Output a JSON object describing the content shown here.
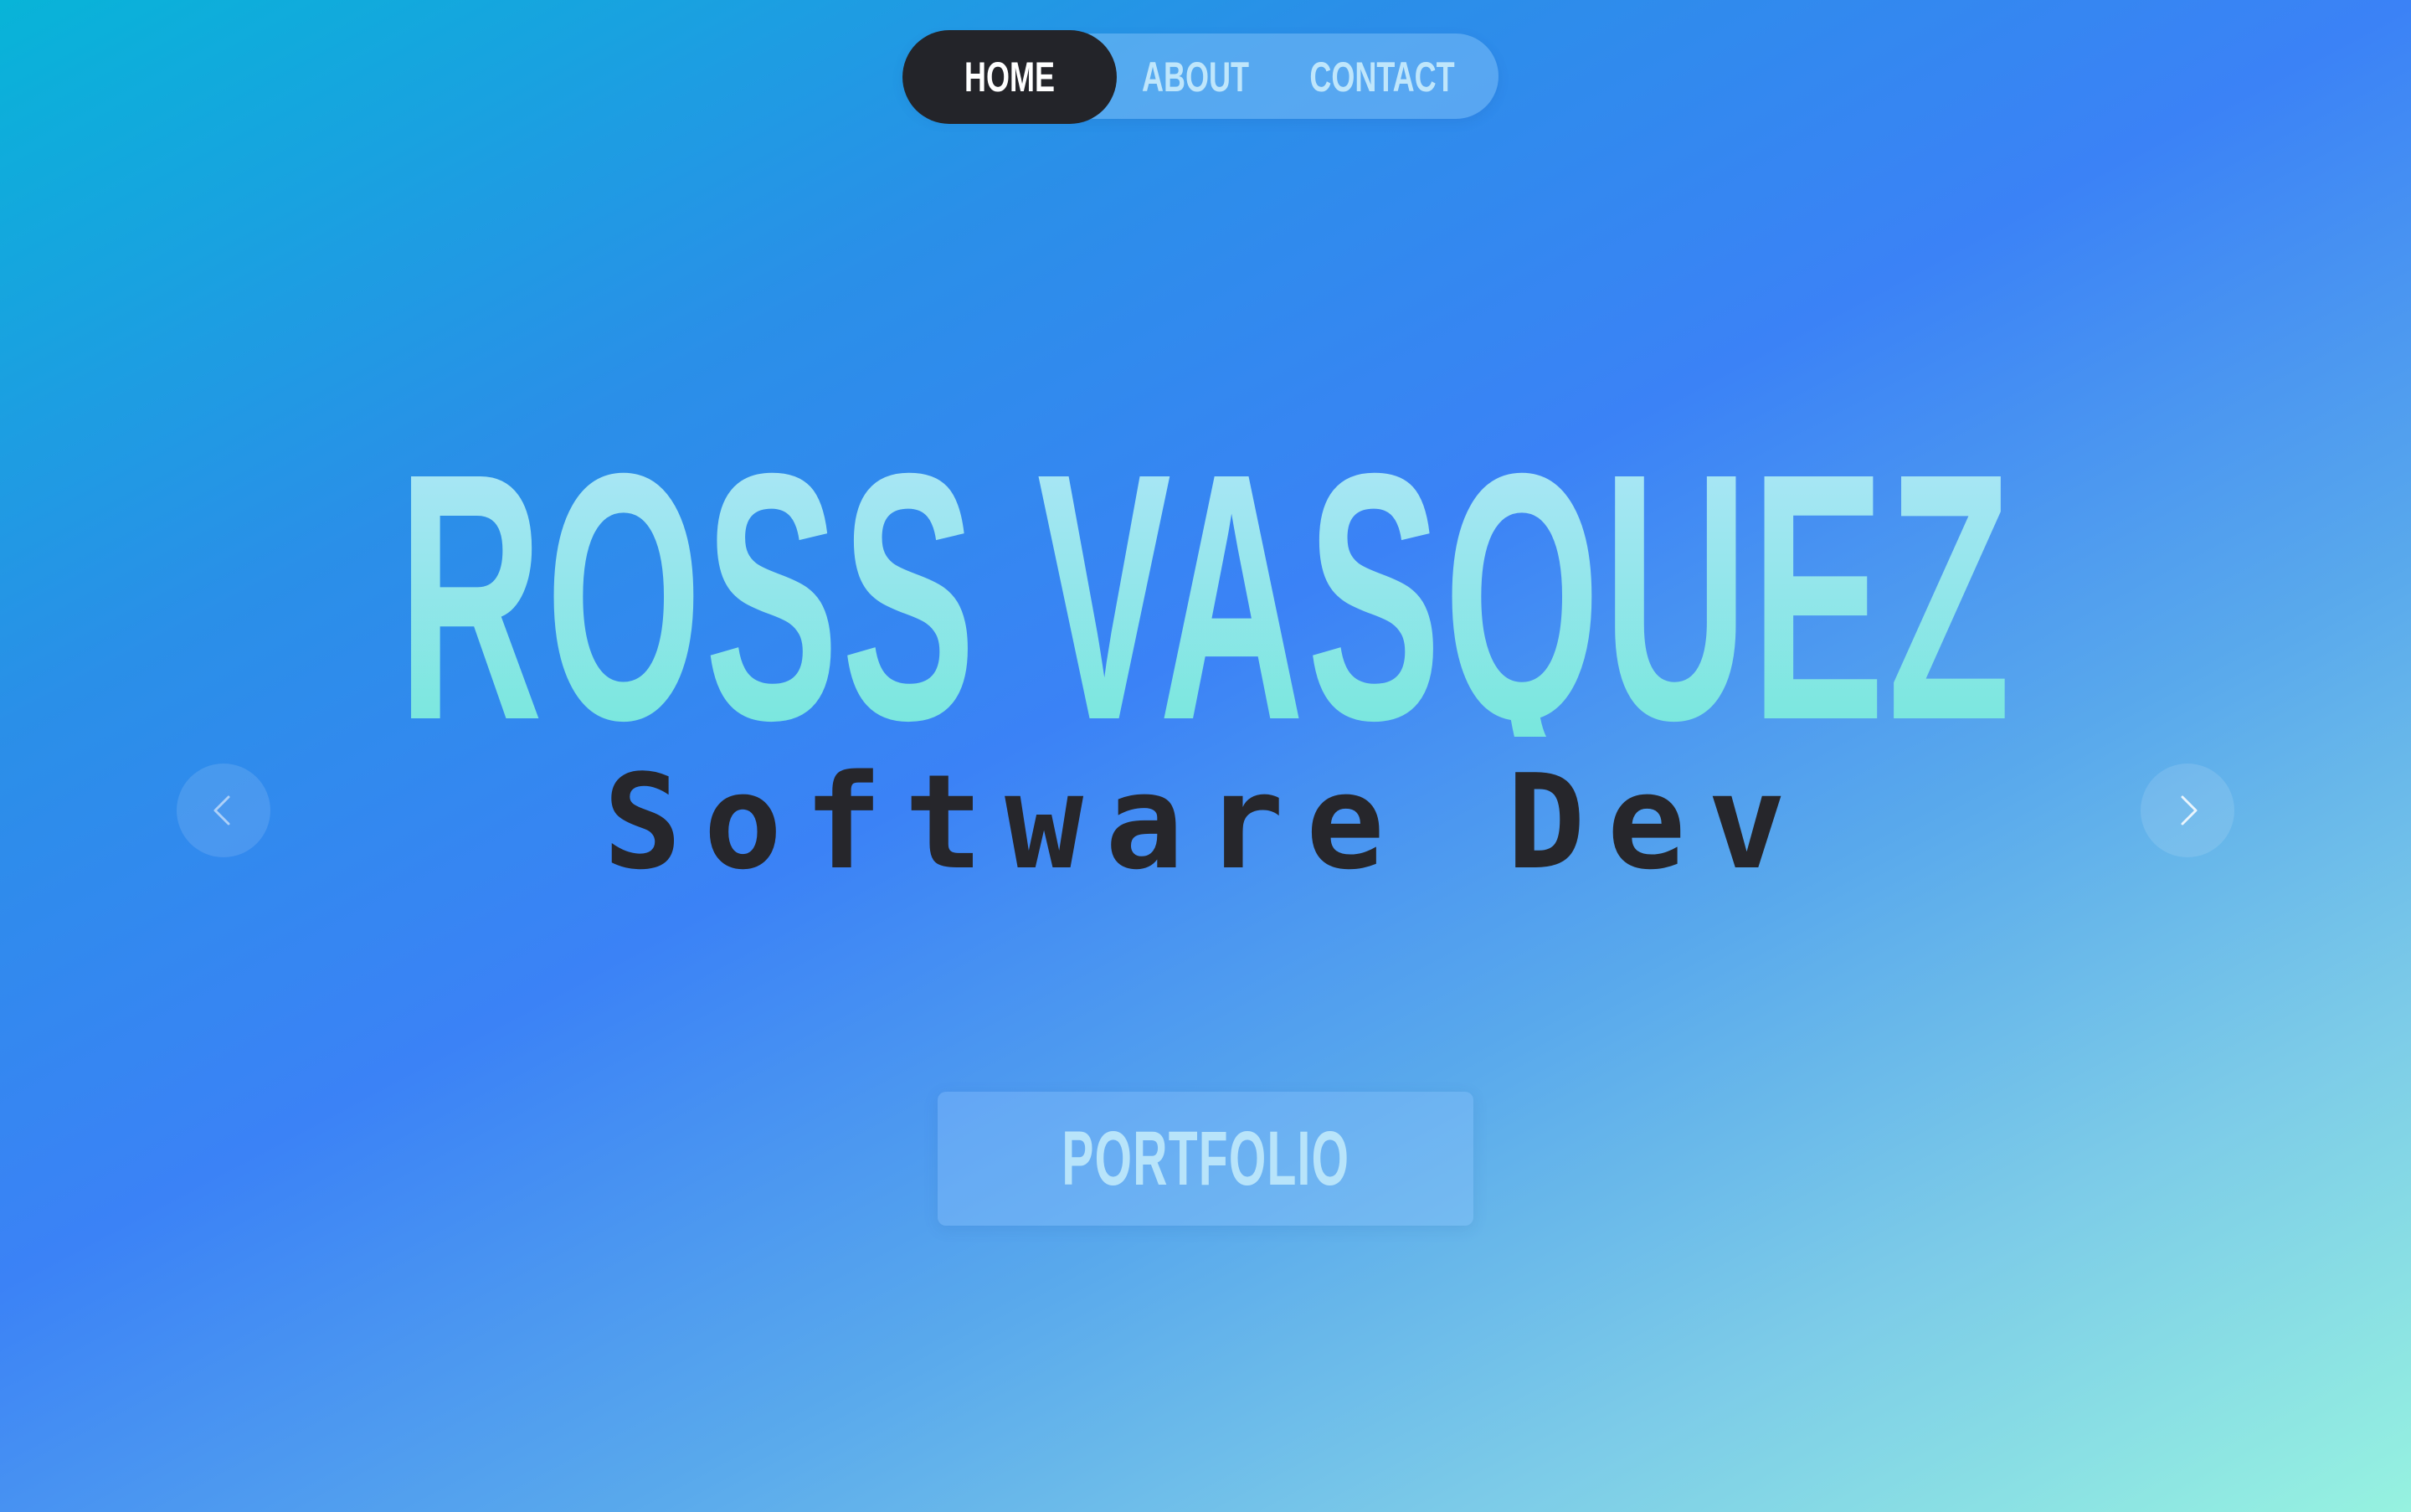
{
  "nav": {
    "items": [
      {
        "label": "HOME",
        "active": true
      },
      {
        "label": "ABOUT",
        "active": false
      },
      {
        "label": "CONTACT",
        "active": false
      }
    ]
  },
  "hero": {
    "name": "ROSS VASQUEZ",
    "subtitle": "Software Dev"
  },
  "carousel": {
    "prev_icon": "chevron-left-icon",
    "next_icon": "chevron-right-icon"
  },
  "cta": {
    "label": "PORTFOLIO"
  },
  "colors": {
    "nav_active_bg": "#232429",
    "name_gradient_top": "#b4e6fb",
    "name_gradient_bottom": "#6ee7d8",
    "subtitle_text": "#26262b",
    "background_start": "#08b4d8",
    "background_mid": "#3b82f6",
    "background_end": "#96f2e0"
  }
}
